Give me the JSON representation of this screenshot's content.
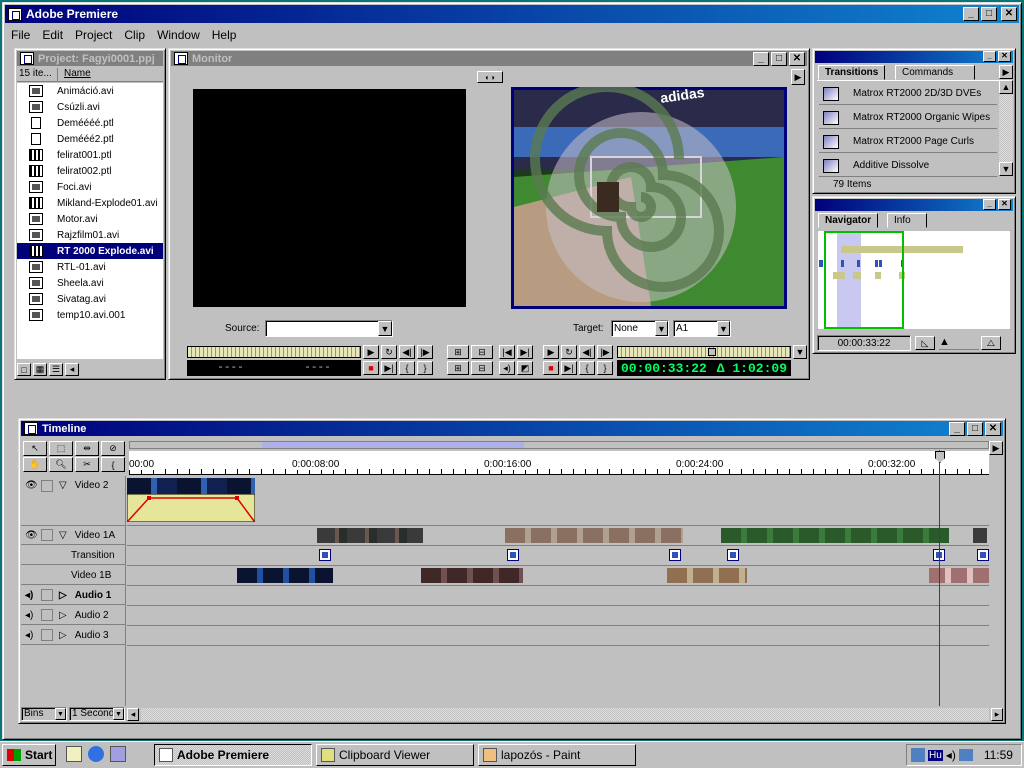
{
  "app": {
    "title": "Adobe Premiere",
    "menus": [
      "File",
      "Edit",
      "Project",
      "Clip",
      "Window",
      "Help"
    ]
  },
  "project": {
    "title": "Project: Fagyi0001.ppj",
    "count_label": "15 ite...",
    "name_header": "Name",
    "items": [
      {
        "name": "Animáció.avi",
        "icon": "still-clip-icon"
      },
      {
        "name": "Csúzli.avi",
        "icon": "still-clip-icon"
      },
      {
        "name": "Deméééé.ptl",
        "icon": "document-icon"
      },
      {
        "name": "Demééé2.ptl",
        "icon": "document-icon"
      },
      {
        "name": "felirat001.ptl",
        "icon": "film-icon"
      },
      {
        "name": "felirat002.ptl",
        "icon": "film-icon"
      },
      {
        "name": "Foci.avi",
        "icon": "still-clip-icon"
      },
      {
        "name": "Mikland-Explode01.avi",
        "icon": "film-icon"
      },
      {
        "name": "Motor.avi",
        "icon": "still-clip-icon"
      },
      {
        "name": "Rajzfilm01.avi",
        "icon": "still-clip-icon"
      },
      {
        "name": "RT 2000 Explode.avi",
        "icon": "film-icon",
        "selected": true
      },
      {
        "name": "RTL-01.avi",
        "icon": "still-clip-icon"
      },
      {
        "name": "Sheela.avi",
        "icon": "still-clip-icon"
      },
      {
        "name": "Sivatag.avi",
        "icon": "still-clip-icon"
      },
      {
        "name": "temp10.avi.001",
        "icon": "clip-icon"
      }
    ]
  },
  "monitor": {
    "title": "Monitor",
    "source_label": "Source:",
    "source_value": "",
    "target_label": "Target:",
    "target_video": "None",
    "target_audio": "A1",
    "source_tc_in": "----",
    "source_tc_out": "----",
    "program_tc": "00:00:33:22",
    "program_duration": "Δ 1:02:09"
  },
  "transitions": {
    "tabs": [
      "Transitions",
      "Commands"
    ],
    "items": [
      "Matrox RT2000 2D/3D DVEs",
      "Matrox RT2000 Organic Wipes",
      "Matrox RT2000 Page Curls",
      "Additive Dissolve"
    ],
    "count": "79 Items"
  },
  "navigator": {
    "tabs": [
      "Navigator",
      "Info"
    ],
    "timecode": "00:00:33:22"
  },
  "timeline": {
    "title": "Timeline",
    "ruler": [
      "00:00",
      "0:00:08:00",
      "0:00:16:00",
      "0:00:24:00",
      "0:00:32:00"
    ],
    "tracks": [
      {
        "name": "Video 2"
      },
      {
        "name": "Video 1A"
      },
      {
        "name": "Transition"
      },
      {
        "name": "Video 1B"
      },
      {
        "name": "Audio 1"
      },
      {
        "name": "Audio 2"
      },
      {
        "name": "Audio 3"
      }
    ],
    "bins_label": "Bins",
    "zoom_label": "1 Second"
  },
  "taskbar": {
    "start": "Start",
    "tasks": [
      "Adobe Premiere",
      "Clipboard Viewer",
      "lapozós - Paint"
    ],
    "lang": "Hu",
    "time": "11:59"
  },
  "colors": {
    "titlebar": "#00007b",
    "desktop": "#0a7576",
    "timecode": "#00ff60",
    "video2_clip": "#e6e69a",
    "rubberband": "#e00000"
  }
}
